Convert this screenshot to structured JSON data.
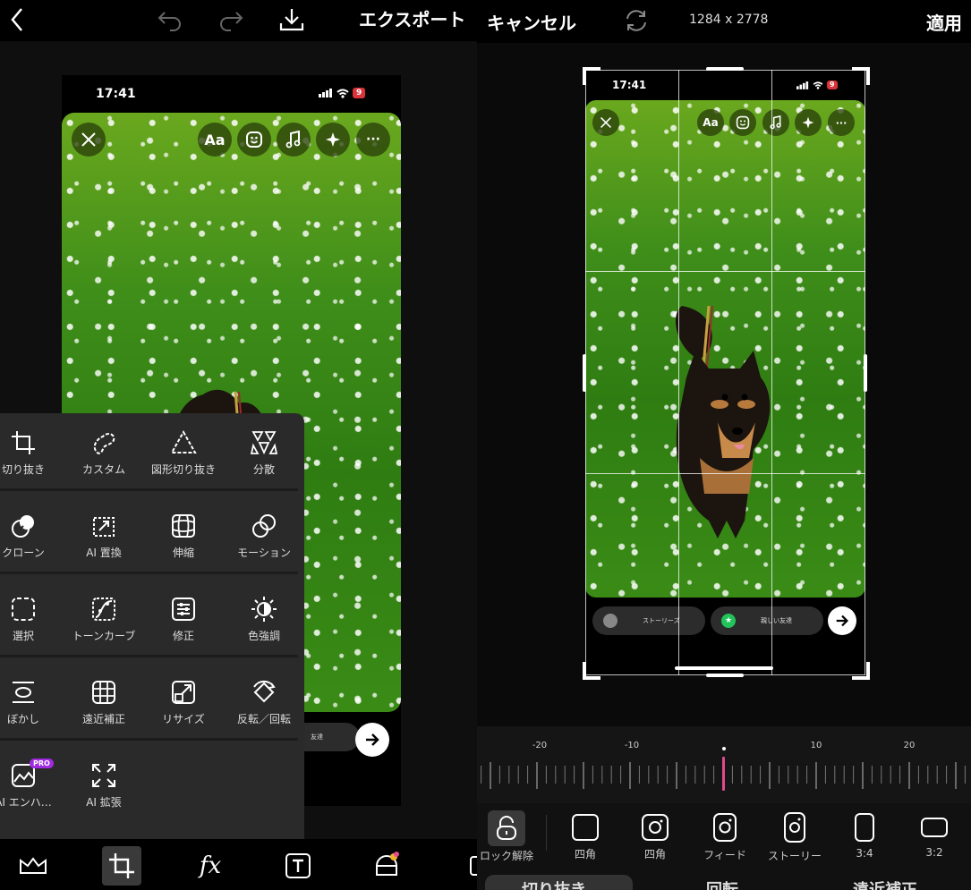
{
  "left": {
    "toolbar": {
      "export_label": "エクスポート"
    },
    "story": {
      "time": "17:41",
      "battery": "9",
      "text_button": "Aa",
      "more_button": "···",
      "close_friends_fragment": "友達"
    },
    "tools": [
      {
        "label": "切り抜き",
        "icon": "crop-icon"
      },
      {
        "label": "カスタム",
        "icon": "lasso-icon"
      },
      {
        "label": "図形切り抜き",
        "icon": "shape-crop-icon"
      },
      {
        "label": "分散",
        "icon": "disperse-icon"
      },
      {
        "label": "クローン",
        "icon": "clone-icon"
      },
      {
        "label": "AI 置換",
        "icon": "ai-replace-icon"
      },
      {
        "label": "伸縮",
        "icon": "stretch-icon"
      },
      {
        "label": "モーション",
        "icon": "motion-icon"
      },
      {
        "label": "選択",
        "icon": "select-icon"
      },
      {
        "label": "トーンカーブ",
        "icon": "tone-curve-icon"
      },
      {
        "label": "修正",
        "icon": "adjust-icon"
      },
      {
        "label": "色強調",
        "icon": "color-enhance-icon"
      },
      {
        "label": "ぼかし",
        "icon": "blur-icon"
      },
      {
        "label": "遠近補正",
        "icon": "perspective-icon"
      },
      {
        "label": "リサイズ",
        "icon": "resize-icon"
      },
      {
        "label": "反転／回転",
        "icon": "flip-rotate-icon"
      },
      {
        "label": "AI エンハ…",
        "icon": "ai-enhance-icon",
        "badge": "PRO"
      },
      {
        "label": "AI 拡張",
        "icon": "ai-expand-icon"
      }
    ],
    "bottom_tools": [
      "layers-icon",
      "crop-icon",
      "fx-icon",
      "text-icon",
      "sticker-icon",
      "more-icon"
    ],
    "bottom_fx_label": "fx"
  },
  "right": {
    "toolbar": {
      "cancel_label": "キャンセル",
      "dimensions": "1284 x 2778",
      "apply_label": "適用"
    },
    "story": {
      "time": "17:41",
      "battery": "9",
      "text_button": "Aa",
      "more_button": "···",
      "stories_label": "ストーリーズ",
      "close_friends_label": "親しい友達"
    },
    "ruler": {
      "labels": [
        "-20",
        "-10",
        "10",
        "20"
      ],
      "value": 0
    },
    "ratios": [
      {
        "label": "ロック解除",
        "icon": "unlock-icon"
      },
      {
        "label": "四角",
        "icon": "square-icon"
      },
      {
        "label": "四角",
        "icon": "instagram-square-icon"
      },
      {
        "label": "フィード",
        "icon": "instagram-feed-icon"
      },
      {
        "label": "ストーリー",
        "icon": "instagram-story-icon"
      },
      {
        "label": "3:4",
        "icon": "ratio-3-4-icon"
      },
      {
        "label": "3:2",
        "icon": "ratio-3-2-icon"
      }
    ],
    "tabs": [
      "切り抜き",
      "回転",
      "遠近補正"
    ]
  },
  "colors": {
    "accent": "#e04a8f",
    "pro_badge": "#a12ae0",
    "menu_bg": "#2a2a2a"
  }
}
